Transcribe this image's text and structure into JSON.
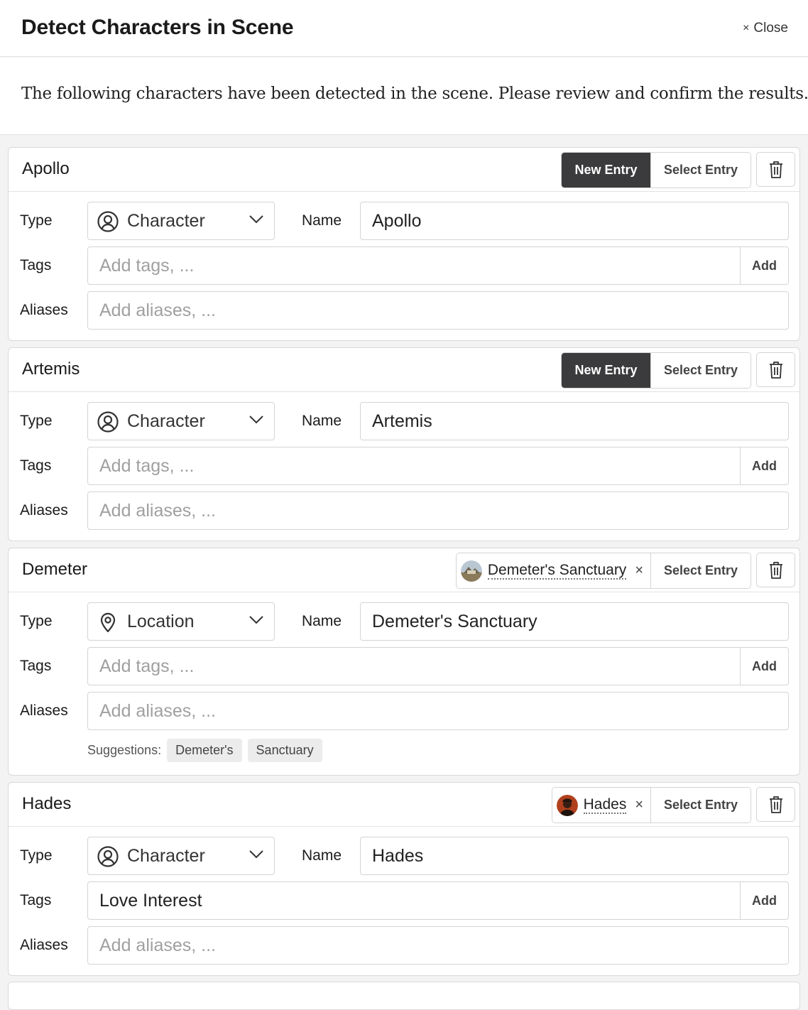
{
  "header": {
    "title": "Detect Characters in Scene",
    "close_label": "Close",
    "close_glyph": "×"
  },
  "intro": "The following characters have been detected in the scene. Please review and confirm the results.",
  "labels": {
    "type": "Type",
    "name": "Name",
    "tags": "Tags",
    "aliases": "Aliases",
    "new_entry": "New Entry",
    "select_entry": "Select Entry",
    "add": "Add",
    "tags_placeholder": "Add tags, ...",
    "aliases_placeholder": "Add aliases, ...",
    "suggestions": "Suggestions:",
    "unlink_glyph": "×"
  },
  "cards": [
    {
      "title": "Apollo",
      "mode": "new",
      "type": "Character",
      "type_icon": "user-circle-icon",
      "name": "Apollo",
      "tags": "",
      "aliases": ""
    },
    {
      "title": "Artemis",
      "mode": "new",
      "type": "Character",
      "type_icon": "user-circle-icon",
      "name": "Artemis",
      "tags": "",
      "aliases": ""
    },
    {
      "title": "Demeter",
      "mode": "linked",
      "linked_entry": "Demeter's Sanctuary",
      "type": "Location",
      "type_icon": "map-pin-icon",
      "name": "Demeter's Sanctuary",
      "tags": "",
      "aliases": "",
      "suggestions": [
        "Demeter's",
        "Sanctuary"
      ]
    },
    {
      "title": "Hades",
      "mode": "linked",
      "linked_entry": "Hades",
      "type": "Character",
      "type_icon": "user-circle-icon",
      "name": "Hades",
      "tags": "Love Interest",
      "aliases": ""
    }
  ]
}
